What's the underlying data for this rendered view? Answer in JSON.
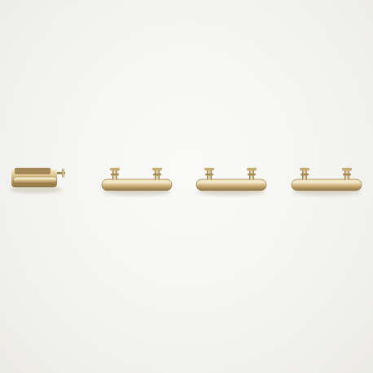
{
  "scene": {
    "description_free": true,
    "colors": {
      "background": "#f6f6f3",
      "gold_light": "#efe2bf",
      "gold_mid": "#c9ad72",
      "gold_dark": "#7c6437",
      "shadow": "#d9d6cc"
    },
    "objects": [
      {
        "kind": "mute-switch"
      },
      {
        "kind": "side-button"
      },
      {
        "kind": "side-button"
      },
      {
        "kind": "side-button"
      }
    ]
  }
}
